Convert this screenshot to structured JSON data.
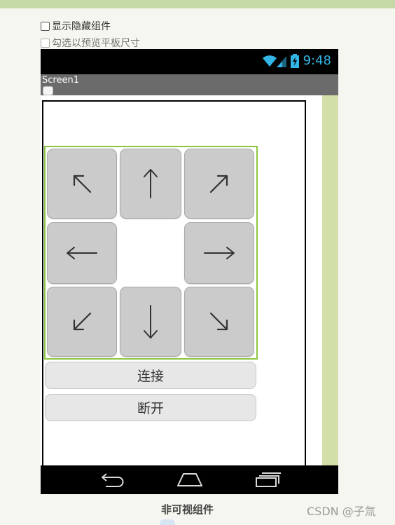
{
  "options": {
    "show_hidden_label": "显示隐藏组件",
    "tablet_preview_label": "勾选以预览平板尺寸"
  },
  "status_bar": {
    "time": "9:48",
    "accent_color": "#33b5e5"
  },
  "screen": {
    "title": "Screen1"
  },
  "direction_pad": {
    "buttons": [
      {
        "name": "up-left",
        "label": "↖"
      },
      {
        "name": "up",
        "label": "↑"
      },
      {
        "name": "up-right",
        "label": "↗"
      },
      {
        "name": "left",
        "label": "←"
      },
      {
        "name": "right",
        "label": "→"
      },
      {
        "name": "down-left",
        "label": "↙"
      },
      {
        "name": "down",
        "label": "↓"
      },
      {
        "name": "down-right",
        "label": "↘"
      }
    ],
    "border_color": "#8cc63f"
  },
  "actions": {
    "connect_label": "连接",
    "disconnect_label": "断开"
  },
  "nav_bar": {
    "icons": [
      "back-icon",
      "home-icon",
      "recent-apps-icon"
    ]
  },
  "non_visible_section": {
    "title": "非可视组件"
  },
  "watermark": "CSDN @子氚"
}
